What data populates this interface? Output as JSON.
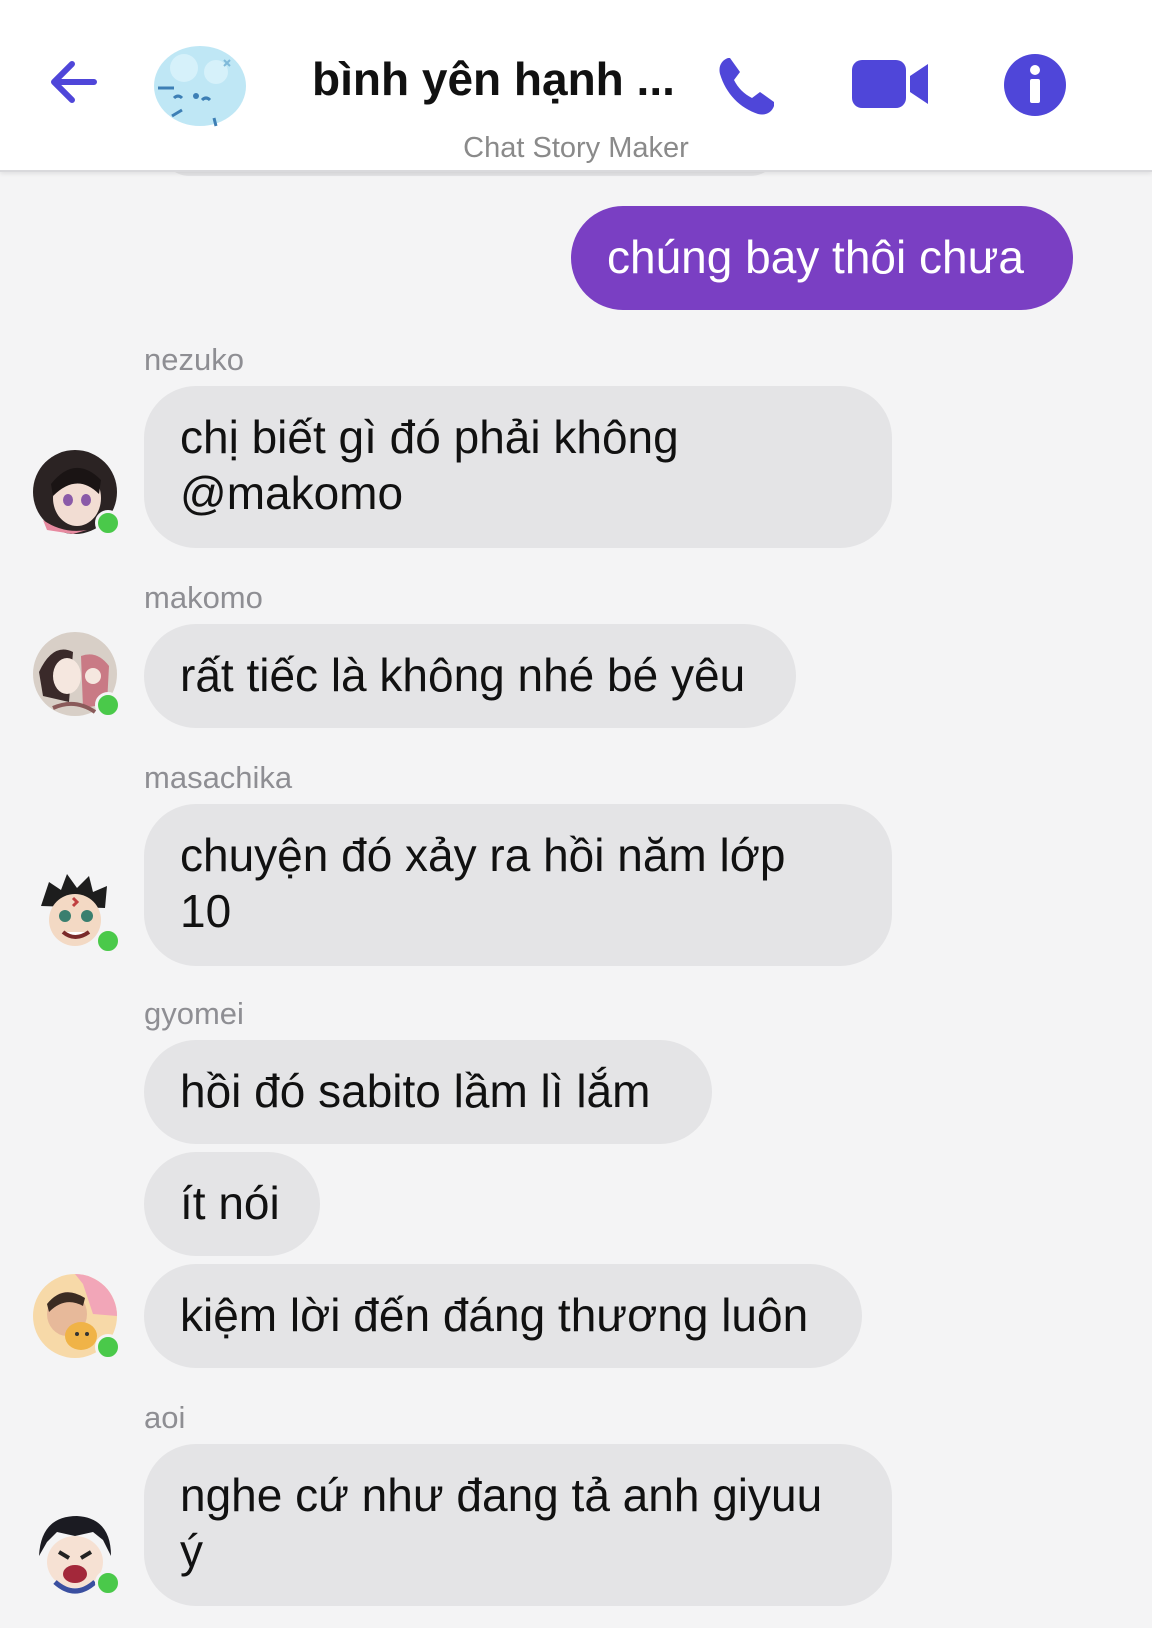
{
  "header": {
    "title": "bình yên hạnh ...",
    "subtitle": "Chat Story Maker",
    "icons": {
      "back": "back-arrow-icon",
      "call": "phone-icon",
      "video": "video-camera-icon",
      "info": "info-icon"
    },
    "colors": {
      "accent": "#4f46d9"
    }
  },
  "messages": [
    {
      "text": "chúng bay thôi chưa",
      "direction": "outgoing"
    },
    {
      "sender": "nezuko",
      "text": "chị biết gì đó phải không\n@makomo"
    },
    {
      "sender": "makomo",
      "text": "rất tiếc là không nhé bé yêu"
    },
    {
      "sender": "masachika",
      "text": "chuyện đó xảy ra hồi năm lớp\n10"
    },
    {
      "sender": "gyomei",
      "text": "hồi đó sabito lầm lì lắm"
    },
    {
      "text": "ít nói"
    },
    {
      "text": "kiệm lời đến đáng thương luôn"
    },
    {
      "sender": "aoi",
      "text": "nghe cứ như đang tả anh giyuu\ný"
    }
  ],
  "colors": {
    "outgoing_bubble": "#7a3fc3",
    "incoming_bubble": "#e4e4e6",
    "online_dot": "#4ac94a"
  }
}
